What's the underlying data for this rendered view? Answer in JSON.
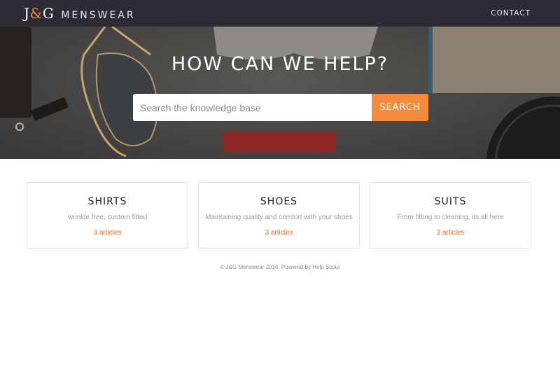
{
  "nav": {
    "brand_mark_left": "J",
    "brand_mark_amp": "&",
    "brand_mark_right": "G",
    "brand_word": "MENSWEAR",
    "contact": "CONTACT"
  },
  "hero": {
    "title": "HOW CAN WE HELP?",
    "search_placeholder": "Search the knowledge base",
    "search_value": "",
    "search_button": "SEARCH"
  },
  "categories": [
    {
      "title": "SHIRTS",
      "description": "wrinkle free, custom fitted",
      "count": "3 articles"
    },
    {
      "title": "SHOES",
      "description": "Maintaining quality and comfort with your shoes",
      "count": "3 articles"
    },
    {
      "title": "SUITS",
      "description": "From fitting to cleaning, its all here",
      "count": "3 articles"
    }
  ],
  "footer": {
    "text": "© J&G Menswear 2014. Powered by Help Scout"
  },
  "colors": {
    "accent": "#f58a3a",
    "link": "#e3692a",
    "nav_bg": "#2e2b36"
  }
}
